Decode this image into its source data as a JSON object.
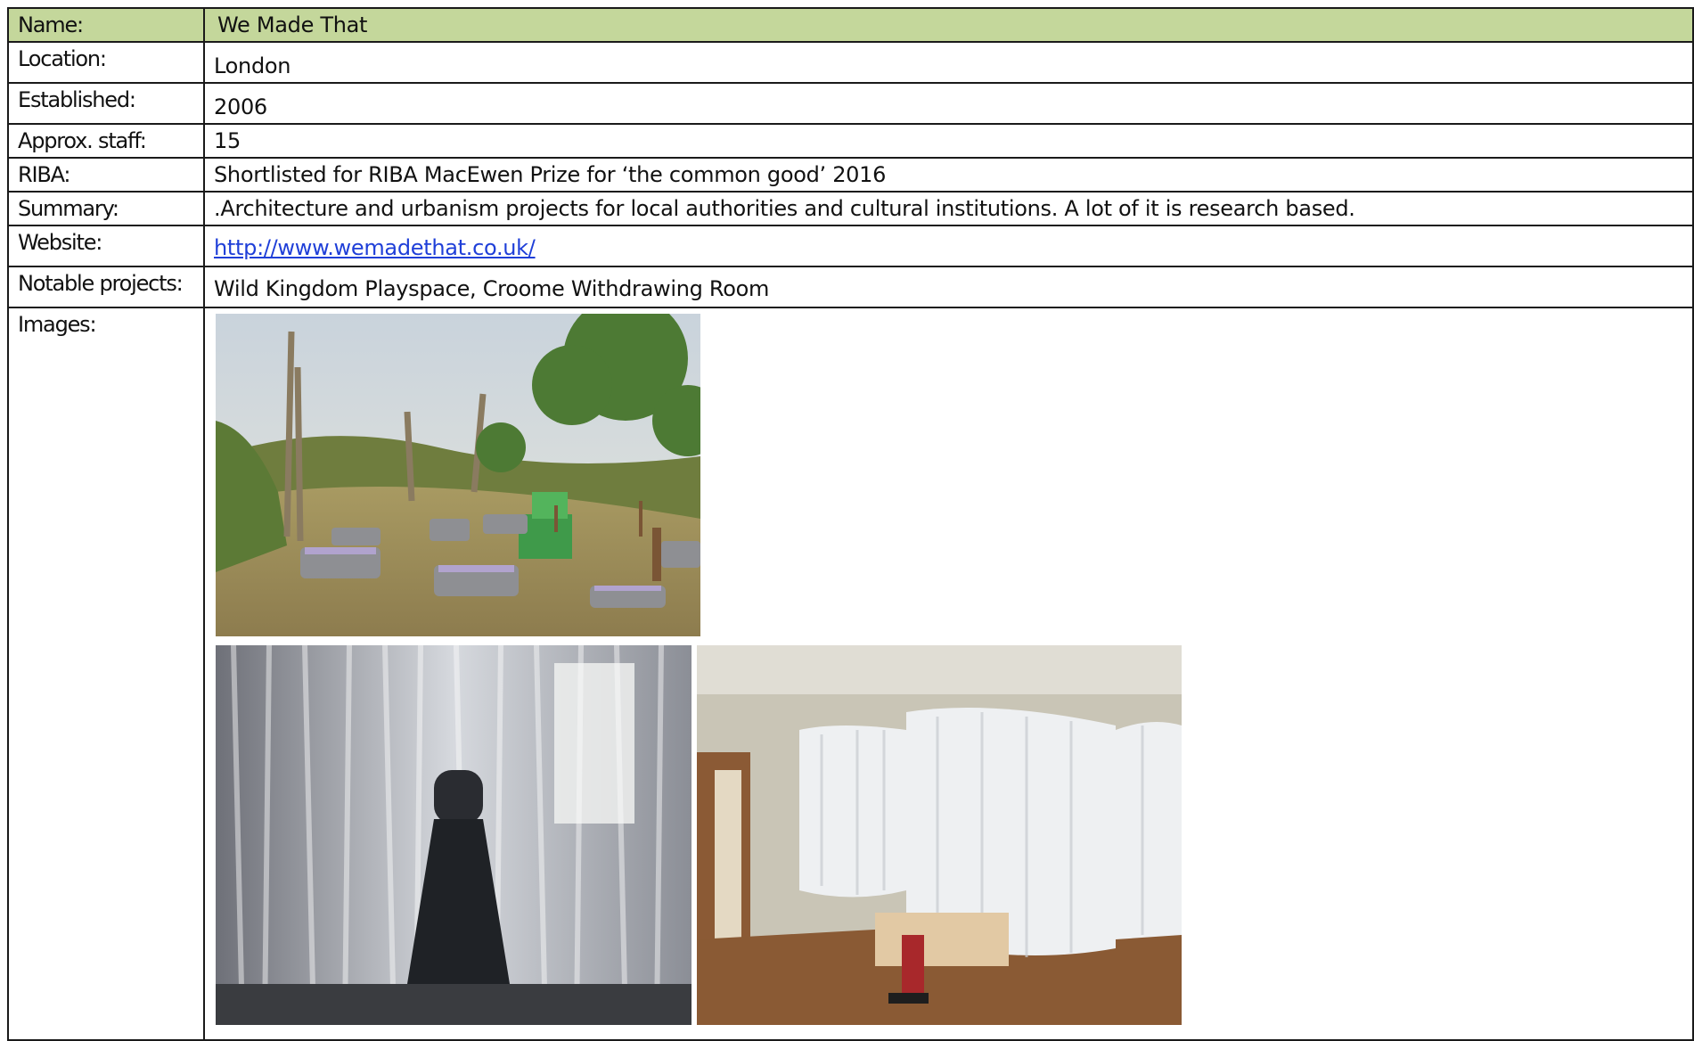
{
  "profile": {
    "name_label": "Name:",
    "name_value": "We Made That",
    "location_label": "Location:",
    "location_value": "London",
    "established_label": "Established:",
    "established_value": "2006",
    "staff_label": "Approx. staff:",
    "staff_value": "15",
    "riba_label": "RIBA:",
    "riba_value": "Shortlisted for RIBA MacEwen Prize for ‘the common good’ 2016",
    "summary_label": "Summary:",
    "summary_value": ".Architecture and urbanism projects for local authorities and cultural institutions. A lot of it is research based.",
    "website_label": "Website:",
    "website_value": "http://www.wemadethat.co.uk/",
    "notable_label": "Notable projects:",
    "notable_value": "Wild Kingdom Playspace, Croome Withdrawing Room",
    "images_label": "Images:"
  },
  "colors": {
    "header_bg": "#c4d79b",
    "border": "#1a1a1a",
    "link": "#1f3fd8"
  },
  "icons": [
    "photo-playspace",
    "photo-curtain-person",
    "photo-withdrawing-room"
  ]
}
